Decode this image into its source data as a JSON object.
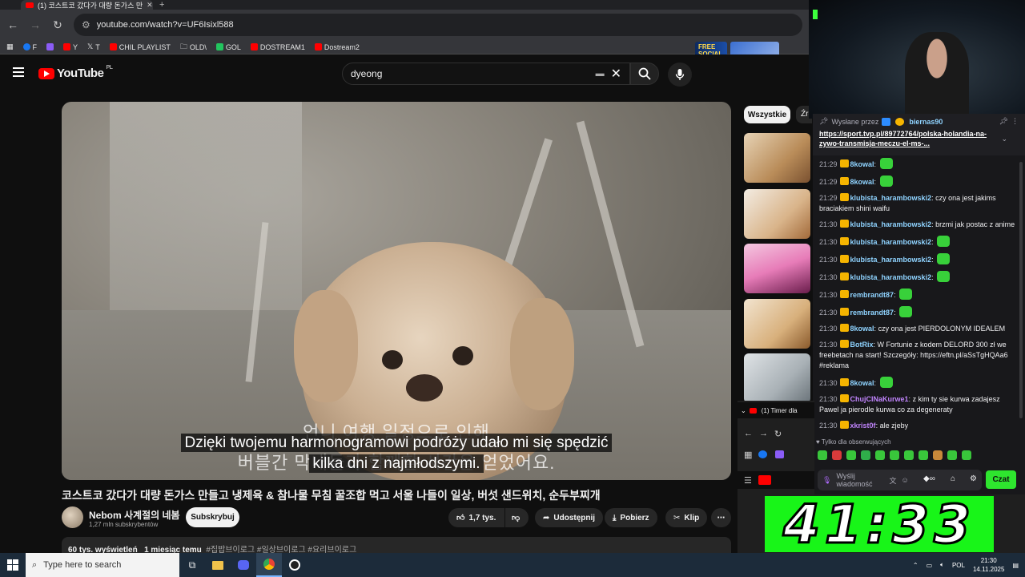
{
  "browser": {
    "tab_title": "(1) 코스트코 갔다가 대량 돈가스 만",
    "url": "youtube.com/watch?v=UF6Isixl588",
    "bookmarks": [
      {
        "label": "F",
        "color": "#1877f2"
      },
      {
        "label": "",
        "color": "#8b5cf6"
      },
      {
        "label": "Y",
        "color": "#ff0000"
      },
      {
        "label": "T",
        "color": "#ffffff"
      },
      {
        "label": "CHIL PLAYLIST",
        "color": "#ff0000"
      },
      {
        "label": "OLD\\",
        "color": "#cccccc"
      },
      {
        "label": "GOL",
        "color": "#22c55e"
      },
      {
        "label": "DOSTREAM1",
        "color": "#ff0000"
      },
      {
        "label": "Dostream2",
        "color": "#ff0000"
      }
    ],
    "ad_banner_text": "FREE SOCIAL CASES"
  },
  "youtube": {
    "logo_text": "YouTube",
    "country_code": "PL",
    "search_value": "dyeong",
    "video": {
      "ghost_korean_top": "언니 여행 일정으로 인해",
      "ghost_korean_bottom": "버블간 막내들과 함께할 시간을 얻었어요.",
      "caption_line1": "Dzięki twojemu harmonogramowi podróży udało mi się spędzić",
      "caption_line2": "kilka dni z najmłodszymi."
    },
    "title": "코스트코 갔다가 대량 돈가스 만들고 냉제육 & 참나물 무침 꿀조합 먹고 서울 나들이 일상, 버섯 샌드위치, 순두부찌개",
    "channel": {
      "name": "Nebom 사계절의 네봄",
      "subscribers": "1,27 mln subskrybentów",
      "subscribe_label": "Subskrybuj"
    },
    "actions": {
      "likes": "1,7 tys.",
      "share": "Udostępnij",
      "download": "Pobierz",
      "clip": "Klip"
    },
    "description": {
      "views": "60 tys. wyświetleń",
      "date": "1 miesiąc temu",
      "tags": "#집밥브이로그 #일상브이로그 #요리브이로그"
    },
    "chips": [
      "Wszystkie",
      "Źró"
    ]
  },
  "chat": {
    "pinned_by_label": "Wysłane przez",
    "pinned_by_user": "biernas90",
    "pinned_link": "https://sport.tvp.pl/89772764/polska-holandia-na-zywo-transmisja-meczu-el-ms-...",
    "messages": [
      {
        "ts": "21:29",
        "user": "8kowal",
        "color": "#8fd3ff",
        "text": "",
        "emote": true
      },
      {
        "ts": "21:29",
        "user": "8kowal",
        "color": "#8fd3ff",
        "text": "",
        "emote": true
      },
      {
        "ts": "21:29",
        "user": "klubista_harambowski2",
        "color": "#8fd3ff",
        "text": "czy ona jest jakims braciakiem shini waifu",
        "emote": false
      },
      {
        "ts": "21:30",
        "user": "klubista_harambowski2",
        "color": "#8fd3ff",
        "text": "brzmi jak postac z anime",
        "emote": false
      },
      {
        "ts": "21:30",
        "user": "klubista_harambowski2",
        "color": "#8fd3ff",
        "text": "",
        "emote": true
      },
      {
        "ts": "21:30",
        "user": "klubista_harambowski2",
        "color": "#8fd3ff",
        "text": "",
        "emote": true
      },
      {
        "ts": "21:30",
        "user": "klubista_harambowski2",
        "color": "#8fd3ff",
        "text": "",
        "emote": true
      },
      {
        "ts": "21:30",
        "user": "rembrandt87",
        "color": "#8fd3ff",
        "text": "",
        "emote": true
      },
      {
        "ts": "21:30",
        "user": "rembrandt87",
        "color": "#8fd3ff",
        "text": "",
        "emote": true
      },
      {
        "ts": "21:30",
        "user": "8kowal",
        "color": "#8fd3ff",
        "text": "czy ona jest PIERDOLONYM IDEALEM",
        "emote": false
      },
      {
        "ts": "21:30",
        "user": "BotRix",
        "color": "#8fd3ff",
        "text": "W Fortunie z kodem DELORD 300 zł we freebetach na start! Szczegóły: https://eftn.pl/aSsTgHQAa6 #reklama",
        "emote": false
      },
      {
        "ts": "21:30",
        "user": "8kowal",
        "color": "#8fd3ff",
        "text": "",
        "emote": true
      },
      {
        "ts": "21:30",
        "user": "ChujCINaKurwe1",
        "color": "#c084fc",
        "text": "z kim ty sie kurwa zadajesz Pawel ja pierodle kurwa co za degeneraty",
        "emote": false
      },
      {
        "ts": "21:30",
        "user": "xkrist0f",
        "color": "#c084fc",
        "text": "ale zjeby",
        "emote": false
      }
    ],
    "followers_only": "Tylko dla obserwujących",
    "input_placeholder": "Wyślij wiadomość",
    "send_label": "Czat"
  },
  "mini_browser": {
    "tab_label": "(1) Timer dla"
  },
  "timer": {
    "value": "41:33"
  },
  "taskbar": {
    "search_placeholder": "Type here to search",
    "language": "POL",
    "time": "21:30",
    "date": "14.11.2025"
  }
}
